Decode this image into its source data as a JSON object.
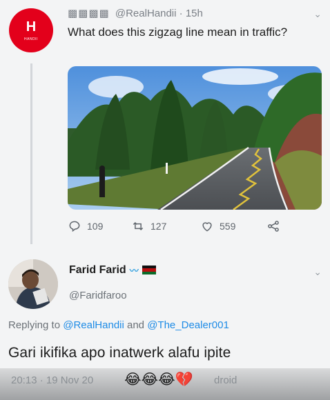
{
  "tweet": {
    "avatar_logo": "H",
    "avatar_sub": "HANDII",
    "display_name": "▩▩▩▩",
    "handle": "@RealHandii",
    "time": "· 15h",
    "text": "What does this zigzag line mean in traffic?",
    "stats": {
      "replies": "109",
      "retweets": "127",
      "likes": "559"
    }
  },
  "reply": {
    "display_name": "Farid Farid",
    "handle": "@Faridfaroo",
    "replying_prefix": "Replying to",
    "mention_1": "@RealHandii",
    "replying_and": "and",
    "mention_2": "@The_Dealer001",
    "text": "Gari ikifika apo inatwerk alafu ipite",
    "timestamp": "20:13 · 19 Nov 20",
    "emojis": "😂😂😂💔",
    "client": "droid"
  },
  "colors": {
    "avatar_brand": "#e3001b",
    "link": "#1d8be6",
    "meta": "#7a7f86"
  },
  "icons": [
    "reply-icon",
    "retweet-icon",
    "like-icon",
    "share-icon",
    "chevron-down-icon"
  ]
}
